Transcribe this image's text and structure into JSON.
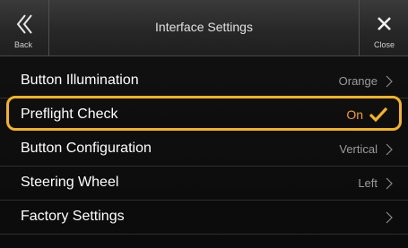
{
  "header": {
    "title": "Interface Settings",
    "back_label": "Back",
    "close_label": "Close"
  },
  "items": [
    {
      "label": "Button Illumination",
      "value": "Orange"
    },
    {
      "label": "Preflight Check",
      "value": "On",
      "selected": true
    },
    {
      "label": "Button Configuration",
      "value": "Vertical"
    },
    {
      "label": "Steering Wheel",
      "value": "Left"
    },
    {
      "label": "Factory Settings",
      "value": ""
    }
  ],
  "colors": {
    "highlight": "#f5b41a",
    "selected_value": "#f0a020",
    "background": "#101010"
  },
  "icons": {
    "back": "double-chevron-left-icon",
    "close": "close-x-icon",
    "row": "chevron-right-icon",
    "selected": "checkmark-icon"
  }
}
